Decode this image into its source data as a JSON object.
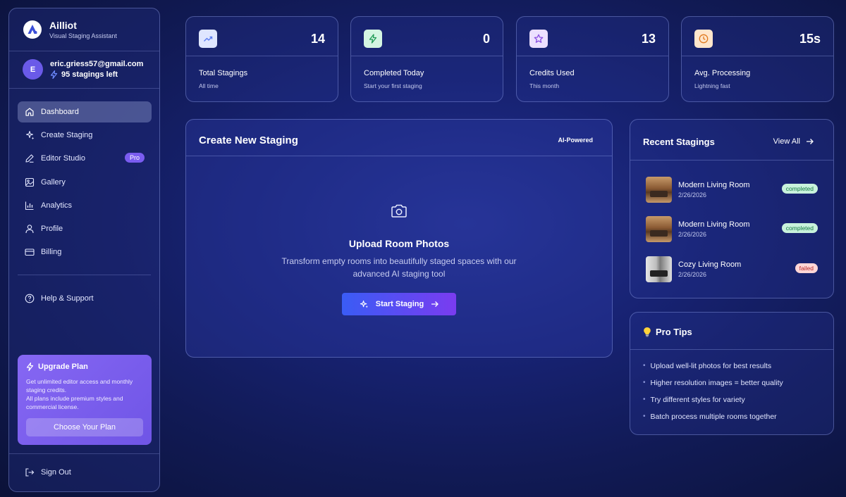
{
  "brand": {
    "name": "Ailliot",
    "subtitle": "Visual Staging Assistant",
    "logo_letter": "A"
  },
  "user": {
    "initial": "E",
    "email": "eric.griess57@gmail.com",
    "credits": "95 stagings left"
  },
  "nav": [
    {
      "label": "Dashboard",
      "icon": "home-icon",
      "active": true
    },
    {
      "label": "Create Staging",
      "icon": "sparkles-icon"
    },
    {
      "label": "Editor Studio",
      "icon": "pencil-icon",
      "badge": "Pro"
    },
    {
      "label": "Gallery",
      "icon": "image-icon"
    },
    {
      "label": "Analytics",
      "icon": "bar-chart-icon"
    },
    {
      "label": "Profile",
      "icon": "user-icon"
    },
    {
      "label": "Billing",
      "icon": "credit-card-icon"
    }
  ],
  "help": {
    "label": "Help & Support"
  },
  "upgrade": {
    "title": "Upgrade Plan",
    "desc1": "Get unlimited editor access and monthly staging credits.",
    "desc2": "All plans include premium styles and commercial license.",
    "button": "Choose Your Plan"
  },
  "signout": {
    "label": "Sign Out"
  },
  "stats": [
    {
      "value": "14",
      "label": "Total Stagings",
      "sub": "All time",
      "icon": "trending-up-icon",
      "color": "#5b7cf0",
      "bg": "#dfe6ff"
    },
    {
      "value": "0",
      "label": "Completed Today",
      "sub": "Start your first staging",
      "icon": "lightning-icon",
      "color": "#1f9a55",
      "bg": "#d4f5e2"
    },
    {
      "value": "13",
      "label": "Credits Used",
      "sub": "This month",
      "icon": "star-icon",
      "color": "#8a4fe0",
      "bg": "#ece0ff"
    },
    {
      "value": "15s",
      "label": "Avg. Processing",
      "sub": "Lightning fast",
      "icon": "clock-icon",
      "color": "#e07a1f",
      "bg": "#ffe6cc"
    }
  ],
  "create": {
    "title": "Create New Staging",
    "badge": "AI-Powered",
    "upload_title": "Upload Room Photos",
    "upload_desc": "Transform empty rooms into beautifully staged spaces with our advanced AI staging tool",
    "button": "Start Staging"
  },
  "recent": {
    "title": "Recent Stagings",
    "view_all": "View All",
    "items": [
      {
        "name": "Modern Living Room",
        "date": "2/26/2026",
        "status": "completed"
      },
      {
        "name": "Modern Living Room",
        "date": "2/26/2026",
        "status": "completed"
      },
      {
        "name": "Cozy Living Room",
        "date": "2/26/2026",
        "status": "failed"
      }
    ]
  },
  "tips": {
    "title": "Pro Tips",
    "items": [
      "Upload well-lit photos for best results",
      "Higher resolution images = better quality",
      "Try different styles for variety",
      "Batch process multiple rooms together"
    ]
  }
}
